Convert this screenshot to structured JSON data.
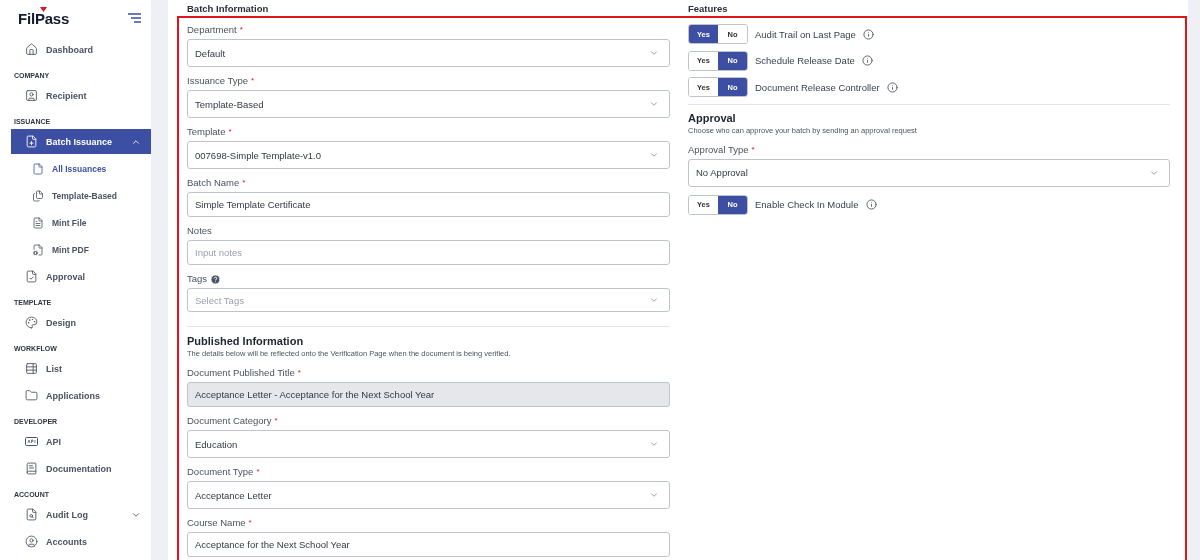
{
  "sidebar": {
    "logo": "FilPass",
    "nav": [
      {
        "kind": "item",
        "label": "Dashboard",
        "selected": false
      },
      {
        "kind": "heading",
        "label": "COMPANY"
      },
      {
        "kind": "item",
        "label": "Recipient",
        "selected": false
      },
      {
        "kind": "heading",
        "label": "ISSUANCE"
      },
      {
        "kind": "item",
        "label": "Batch Issuance",
        "selected": true,
        "expanded": true,
        "children": [
          {
            "label": "All Issuances",
            "selected": true
          },
          {
            "label": "Template-Based",
            "selected": false
          },
          {
            "label": "Mint File",
            "selected": false
          },
          {
            "label": "Mint PDF",
            "selected": false
          }
        ]
      },
      {
        "kind": "item",
        "label": "Approval",
        "selected": false
      },
      {
        "kind": "heading",
        "label": "TEMPLATE"
      },
      {
        "kind": "item",
        "label": "Design",
        "selected": false
      },
      {
        "kind": "heading",
        "label": "WORKFLOW"
      },
      {
        "kind": "item",
        "label": "List",
        "selected": false
      },
      {
        "kind": "item",
        "label": "Applications",
        "selected": false
      },
      {
        "kind": "heading",
        "label": "DEVELOPER"
      },
      {
        "kind": "item",
        "label": "API",
        "selected": false
      },
      {
        "kind": "item",
        "label": "Documentation",
        "selected": false
      },
      {
        "kind": "heading",
        "label": "ACCOUNT"
      },
      {
        "kind": "item",
        "label": "Audit Log",
        "selected": false,
        "expanded": false
      },
      {
        "kind": "item",
        "label": "Accounts",
        "selected": false
      }
    ]
  },
  "batch_information": {
    "title": "Batch Information",
    "fields": [
      {
        "kind": "select",
        "label": "Department",
        "marker": "*",
        "value": "Default"
      },
      {
        "kind": "select",
        "label": "Issuance Type",
        "marker": "*",
        "value": "Template-Based"
      },
      {
        "kind": "select",
        "label": "Template",
        "marker": "*",
        "value": "007698-Simple Template-v1.0"
      },
      {
        "kind": "text",
        "label": "Batch Name",
        "marker": "*",
        "value": "Simple Template Certificate"
      },
      {
        "kind": "text",
        "label": "Notes",
        "placeholder": "Input notes"
      },
      {
        "kind": "select",
        "label": "Tags",
        "help": true,
        "placeholder": "Select Tags"
      }
    ]
  },
  "published_information": {
    "title": "Published Information",
    "description": "The details below will be reflected onto the Verification Page when the document is being verified.",
    "fields": [
      {
        "kind": "text",
        "label": "Document Published Title",
        "marker": "*",
        "value": "Acceptance Letter - Acceptance for the Next School Year",
        "disabled": true
      },
      {
        "kind": "select",
        "label": "Document Category",
        "marker": "*",
        "value": "Education"
      },
      {
        "kind": "select",
        "label": "Document Type",
        "marker": "*",
        "value": "Acceptance Letter"
      },
      {
        "kind": "text",
        "label": "Course Name",
        "marker": "*",
        "value": "Acceptance for the Next School Year"
      }
    ]
  },
  "features": {
    "title": "Features",
    "toggles": [
      {
        "label": "Audit Trail on Last Page",
        "on": true,
        "yes": "Yes",
        "no": "No",
        "info": true
      },
      {
        "label": "Schedule Release Date",
        "on": false,
        "yes": "Yes",
        "no": "No",
        "info": true
      },
      {
        "label": "Document Release Controller",
        "on": false,
        "yes": "Yes",
        "no": "No",
        "info": true
      }
    ]
  },
  "approval": {
    "title": "Approval",
    "description": "Choose who can approve your batch by sending an approval request",
    "fields": [
      {
        "kind": "select",
        "label": "Approval Type",
        "marker": "*",
        "value": "No Approval"
      }
    ],
    "toggles": [
      {
        "label": "Enable Check In Module",
        "on": false,
        "yes": "Yes",
        "no": "No",
        "info": true
      }
    ]
  }
}
